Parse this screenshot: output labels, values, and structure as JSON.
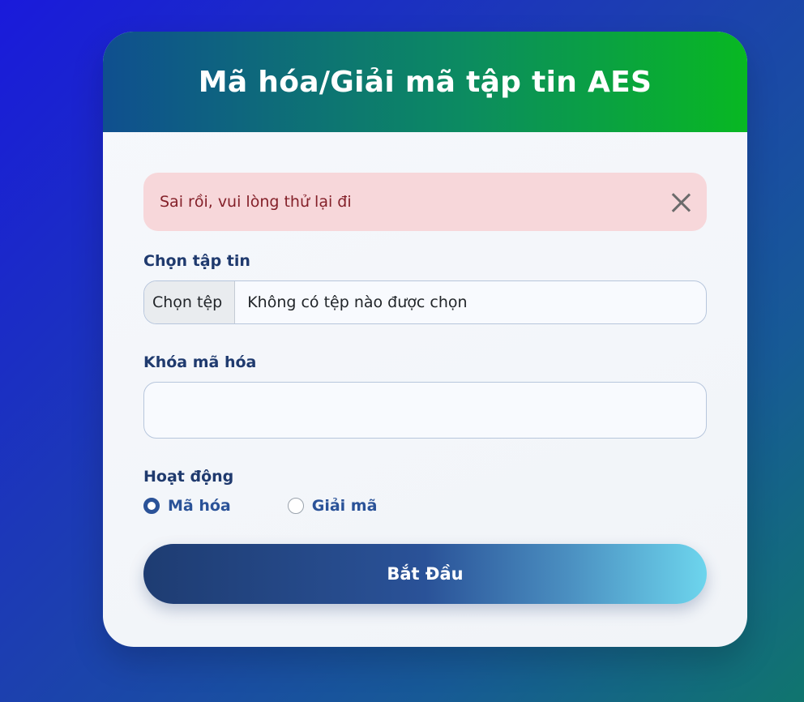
{
  "header": {
    "title": "Mã hóa/Giải mã tập tin AES"
  },
  "alert": {
    "message": "Sai rồi, vui lòng thử lại đi",
    "close_icon": "close-icon"
  },
  "file_field": {
    "label": "Chọn tập tin",
    "button_label": "Chọn tệp",
    "status_text": "Không có tệp nào được chọn"
  },
  "key_field": {
    "label": "Khóa mã hóa",
    "value": ""
  },
  "operation": {
    "label": "Hoạt động",
    "options": [
      {
        "label": "Mã hóa",
        "selected": true
      },
      {
        "label": "Giải mã",
        "selected": false
      }
    ]
  },
  "submit": {
    "label": "Bắt Đầu"
  },
  "colors": {
    "alert_bg": "#f7d7da",
    "alert_text": "#842029",
    "label_color": "#1f3a6e",
    "radio_accent": "#2a5298"
  }
}
